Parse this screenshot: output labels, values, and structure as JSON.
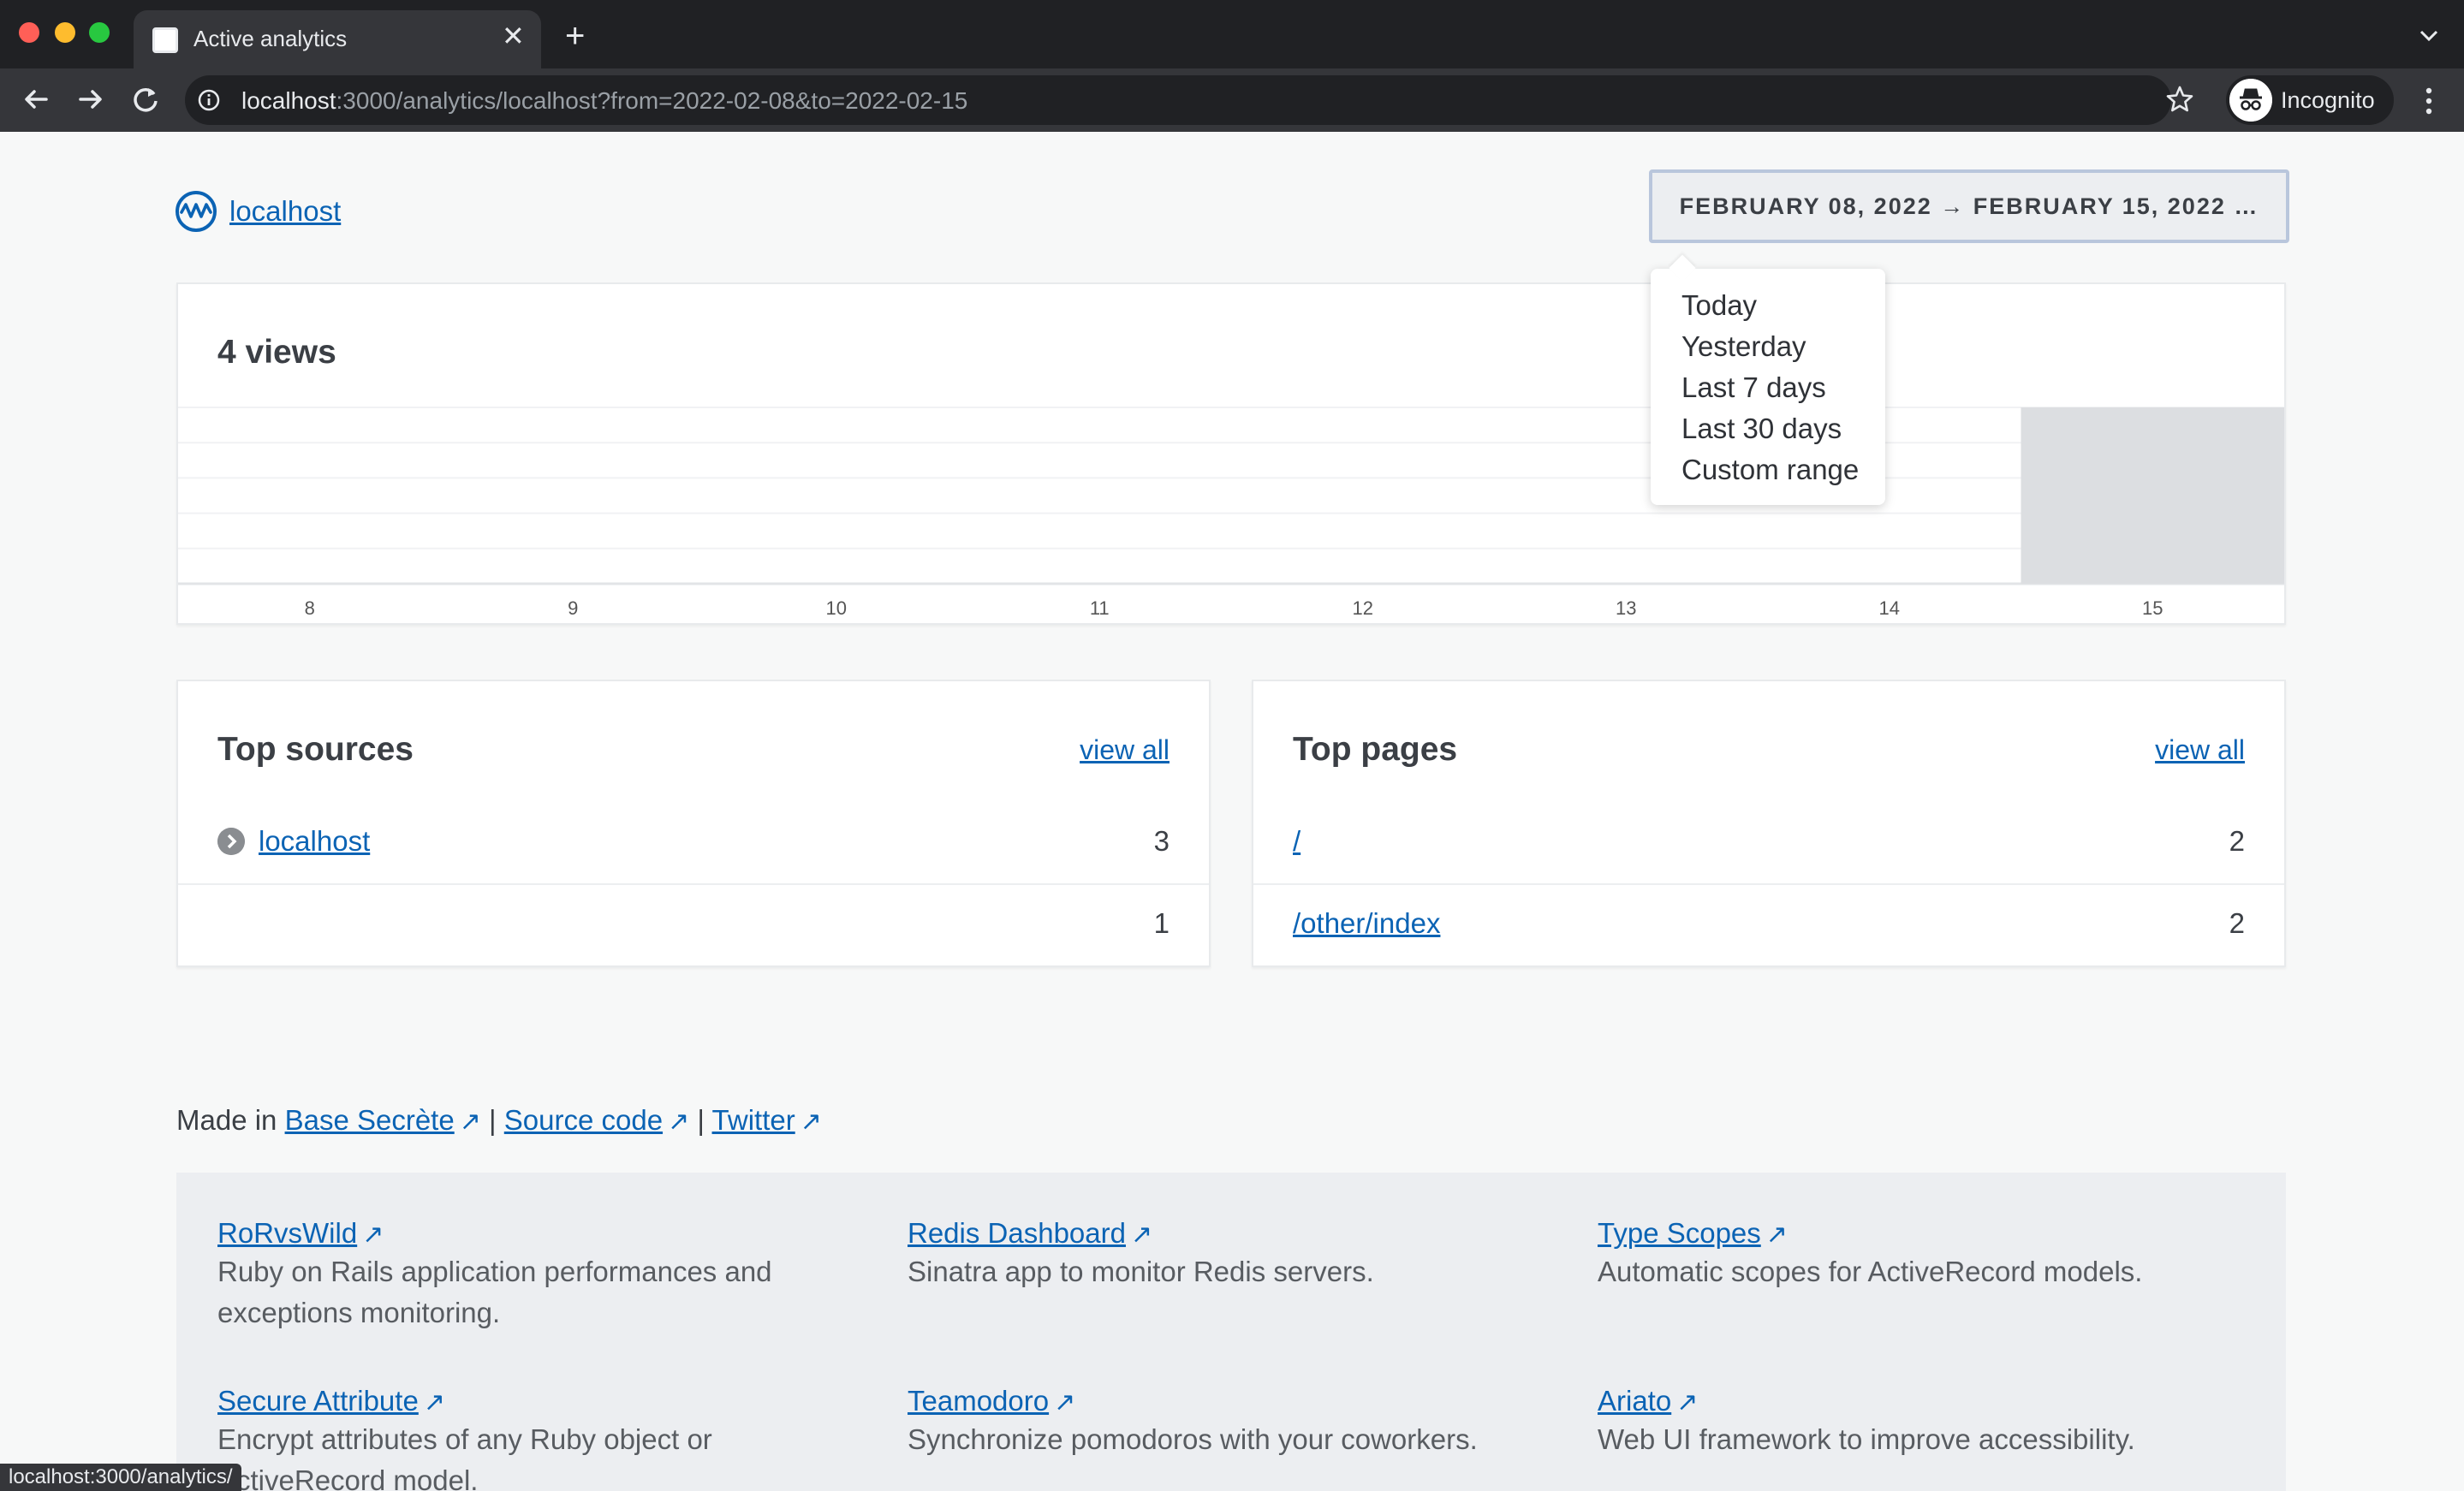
{
  "browser": {
    "tab_title": "Active analytics",
    "url_host": "localhost",
    "url_rest": ":3000/analytics/localhost?from=2022-02-08&to=2022-02-15",
    "profile_label": "Incognito",
    "status_bar": "localhost:3000/analytics/"
  },
  "header": {
    "site_link": "localhost",
    "date_range": "FEBRUARY 08, 2022 → FEBRUARY 15, 2022 …"
  },
  "range_menu": {
    "items": [
      "Today",
      "Yesterday",
      "Last 7 days",
      "Last 30 days",
      "Custom range"
    ]
  },
  "views_card": {
    "title": "4 views"
  },
  "chart_data": {
    "type": "bar",
    "categories": [
      "8",
      "9",
      "10",
      "11",
      "12",
      "13",
      "14",
      "15"
    ],
    "values": [
      0,
      0,
      0,
      0,
      0,
      0,
      0,
      4
    ],
    "title": "",
    "xlabel": "",
    "ylabel": "",
    "ylim": [
      0,
      4
    ],
    "grid": true,
    "bar_color": "#dcdee1"
  },
  "top_sources": {
    "title": "Top sources",
    "view_all": "view all",
    "rows": [
      {
        "label": "localhost",
        "value": "3"
      },
      {
        "label": "",
        "value": "1"
      }
    ]
  },
  "top_pages": {
    "title": "Top pages",
    "view_all": "view all",
    "rows": [
      {
        "label": "/",
        "value": "2"
      },
      {
        "label": "/other/index",
        "value": "2"
      }
    ]
  },
  "footer": {
    "made_in": "Made in",
    "base_secrete": "Base Secrète",
    "separator": "|",
    "source_code": "Source code",
    "twitter": "Twitter",
    "arrow": "↗"
  },
  "products": [
    {
      "name": "RoRvsWild",
      "desc": "Ruby on Rails application performances and exceptions monitoring."
    },
    {
      "name": "Redis Dashboard",
      "desc": "Sinatra app to monitor Redis servers."
    },
    {
      "name": "Type Scopes",
      "desc": "Automatic scopes for ActiveRecord models."
    },
    {
      "name": "Secure Attribute",
      "desc": "Encrypt attributes of any Ruby object or ActiveRecord model."
    },
    {
      "name": "Teamodoro",
      "desc": "Synchronize pomodoros with your coworkers."
    },
    {
      "name": "Ariato",
      "desc": "Web UI framework to improve accessibility."
    }
  ],
  "colors": {
    "link": "#0b63b4",
    "chrome_dark": "#202124",
    "chrome_mid": "#35363a",
    "page_bg": "#f7f8f8"
  }
}
